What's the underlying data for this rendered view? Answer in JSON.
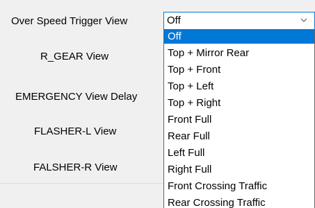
{
  "labels": {
    "over_speed_trigger": "Over Speed Trigger View",
    "r_gear": "R_GEAR View",
    "emergency_delay": "EMERGENCY View Delay",
    "flasher_l": "FLASHER-L View",
    "falsher_r": "FALSHER-R View"
  },
  "select": {
    "value": "Off",
    "arrow_icon": "chevron-down-icon",
    "options": [
      "Off",
      "Top + Mirror Rear",
      "Top + Front",
      "Top + Left",
      "Top + Right",
      "Front Full",
      "Rear Full",
      "Left Full",
      "Right Full",
      "Front Crossing Traffic",
      "Rear Crossing Traffic"
    ],
    "selected_index": 0
  },
  "colors": {
    "focus_border": "#0078d7",
    "selection_bg": "#0078d7",
    "selection_text": "#ffffff",
    "window_bg": "#f0f0f0"
  }
}
